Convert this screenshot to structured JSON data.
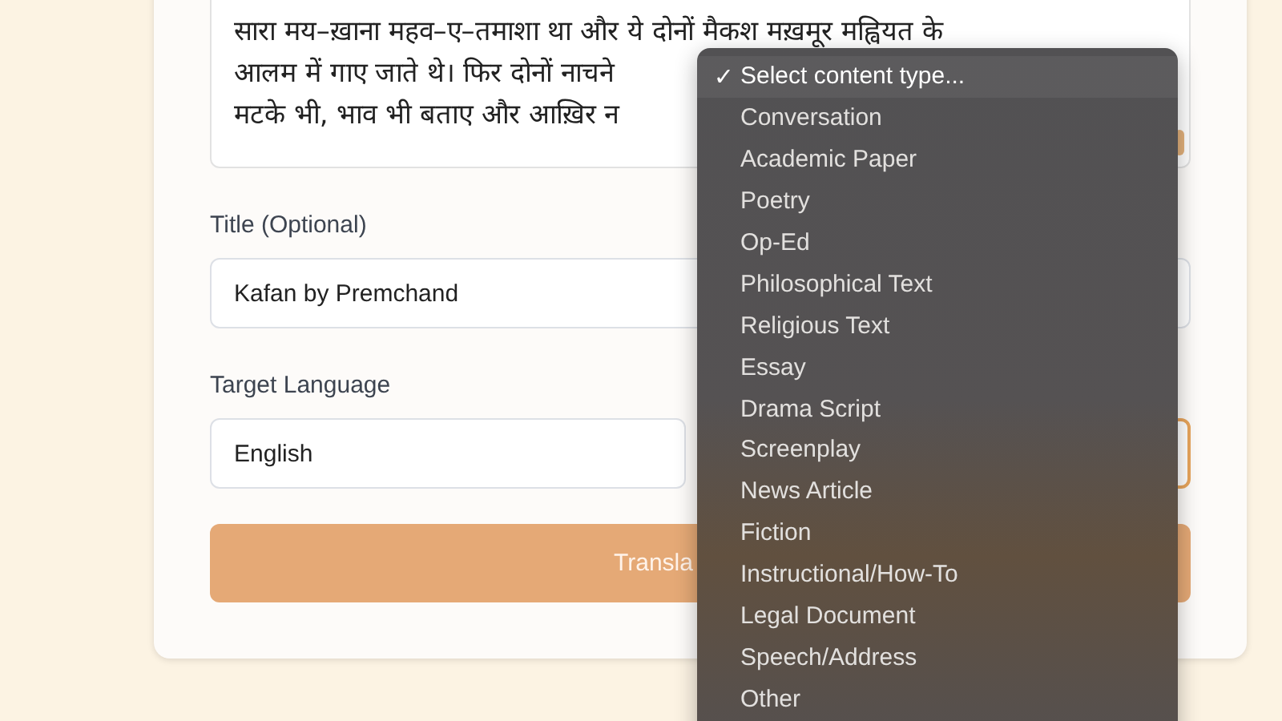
{
  "source_text": {
    "lines": [
      "सारा मय–ख़ाना महव–ए–तमाशा था और ये दोनों मैकश मख़मूर मह्वियत के",
      "आलम में गाए जाते थे। फिर दोनों नाचने",
      "मटके भी, भाव भी बताए और आख़िर न"
    ]
  },
  "title_field": {
    "label": "Title (Optional)",
    "value": "Kafan by Premchand"
  },
  "target_language": {
    "label": "Target Language",
    "value": "English"
  },
  "content_type_select": {
    "focused": true
  },
  "translate_button": {
    "label": "Transla"
  },
  "content_type_menu": {
    "check": "✓",
    "items": [
      {
        "label": "Select content type...",
        "selected": true
      },
      {
        "label": "Conversation",
        "selected": false
      },
      {
        "label": "Academic Paper",
        "selected": false
      },
      {
        "label": "Poetry",
        "selected": false
      },
      {
        "label": "Op-Ed",
        "selected": false
      },
      {
        "label": "Philosophical Text",
        "selected": false
      },
      {
        "label": "Religious Text",
        "selected": false
      },
      {
        "label": "Essay",
        "selected": false
      },
      {
        "label": "Drama Script",
        "selected": false
      },
      {
        "label": "Screenplay",
        "selected": false
      },
      {
        "label": "News Article",
        "selected": false
      },
      {
        "label": "Fiction",
        "selected": false
      },
      {
        "label": "Instructional/How-To",
        "selected": false
      },
      {
        "label": "Legal Document",
        "selected": false
      },
      {
        "label": "Speech/Address",
        "selected": false
      },
      {
        "label": "Other",
        "selected": false
      }
    ]
  }
}
